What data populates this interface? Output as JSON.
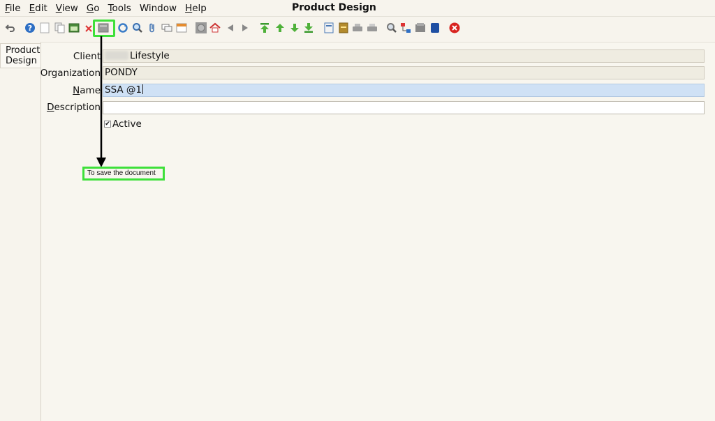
{
  "menu": {
    "items": [
      {
        "mn": "F",
        "rest": "ile"
      },
      {
        "mn": "E",
        "rest": "dit"
      },
      {
        "mn": "V",
        "rest": "iew"
      },
      {
        "mn": "G",
        "rest": "o"
      },
      {
        "mn": "T",
        "rest": "ools"
      },
      {
        "mn": "",
        "rest": "Window"
      },
      {
        "mn": "H",
        "rest": "elp"
      }
    ]
  },
  "window": {
    "title": "Product Design"
  },
  "toolbar": {
    "icons": [
      "undo-icon",
      "help-icon",
      "new-icon",
      "copy-icon",
      "archive-icon",
      "delete-icon",
      "save-icon",
      "refresh-icon",
      "find-icon",
      "attachment-icon",
      "chat-icon",
      "calendar-icon",
      "history-icon",
      "home-icon",
      "back-icon",
      "forward-icon",
      "first-record-icon",
      "previous-record-icon",
      "next-record-icon",
      "last-record-icon",
      "report-icon",
      "archive-doc-icon",
      "print-icon",
      "print-preview-icon",
      "zoom-across-icon",
      "workflow-icon",
      "product-info-icon",
      "lock-icon",
      "close-window-icon"
    ]
  },
  "tabs": {
    "product_design": {
      "line1": "Product",
      "line2": "Design"
    }
  },
  "form": {
    "client": {
      "label": "Client",
      "value": "Lifestyle"
    },
    "organization": {
      "label": "Organization",
      "value": "PONDY"
    },
    "name": {
      "label_mn": "N",
      "label_rest": "ame",
      "value": "SSA @1"
    },
    "description": {
      "label_mn": "D",
      "label_rest": "escription",
      "value": ""
    },
    "active": {
      "label": "Active",
      "checked": "✔"
    }
  },
  "annotation": {
    "callout_text": "To save the document",
    "accent": "#3ee03a"
  }
}
